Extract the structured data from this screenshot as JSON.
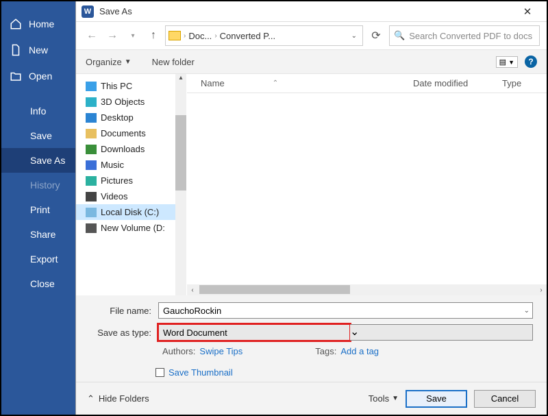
{
  "sidebar": {
    "items": [
      {
        "label": "Home",
        "icon": "home-icon"
      },
      {
        "label": "New",
        "icon": "new-doc-icon"
      },
      {
        "label": "Open",
        "icon": "open-folder-icon"
      },
      {
        "label": "Info"
      },
      {
        "label": "Save"
      },
      {
        "label": "Save As",
        "active": true
      },
      {
        "label": "History",
        "dim": true
      },
      {
        "label": "Print"
      },
      {
        "label": "Share"
      },
      {
        "label": "Export"
      },
      {
        "label": "Close"
      }
    ]
  },
  "dialog": {
    "title": "Save As",
    "path": {
      "seg1": "Doc...",
      "seg2": "Converted P..."
    },
    "search_placeholder": "Search Converted PDF to docs",
    "toolbar": {
      "organize": "Organize",
      "new_folder": "New folder"
    },
    "columns": {
      "name": "Name",
      "date": "Date modified",
      "type": "Type"
    },
    "tree": [
      {
        "label": "This PC",
        "icon": "ic-pc"
      },
      {
        "label": "3D Objects",
        "icon": "ic-3d"
      },
      {
        "label": "Desktop",
        "icon": "ic-desk"
      },
      {
        "label": "Documents",
        "icon": "ic-doc"
      },
      {
        "label": "Downloads",
        "icon": "ic-dl"
      },
      {
        "label": "Music",
        "icon": "ic-mus"
      },
      {
        "label": "Pictures",
        "icon": "ic-pic"
      },
      {
        "label": "Videos",
        "icon": "ic-vid"
      },
      {
        "label": "Local Disk (C:)",
        "icon": "ic-disk",
        "selected": true
      },
      {
        "label": "New Volume (D:",
        "icon": "ic-nv",
        "expand": true
      }
    ],
    "form": {
      "filename_label": "File name:",
      "filename_value": "GauchoRockin",
      "savetype_label": "Save as type:",
      "savetype_value": "Word Document",
      "authors_label": "Authors:",
      "authors_value": "Swipe Tips",
      "tags_label": "Tags:",
      "tags_value": "Add a tag",
      "thumb_label": "Save Thumbnail"
    },
    "footer": {
      "hide_folders": "Hide Folders",
      "tools": "Tools",
      "save": "Save",
      "cancel": "Cancel"
    }
  }
}
